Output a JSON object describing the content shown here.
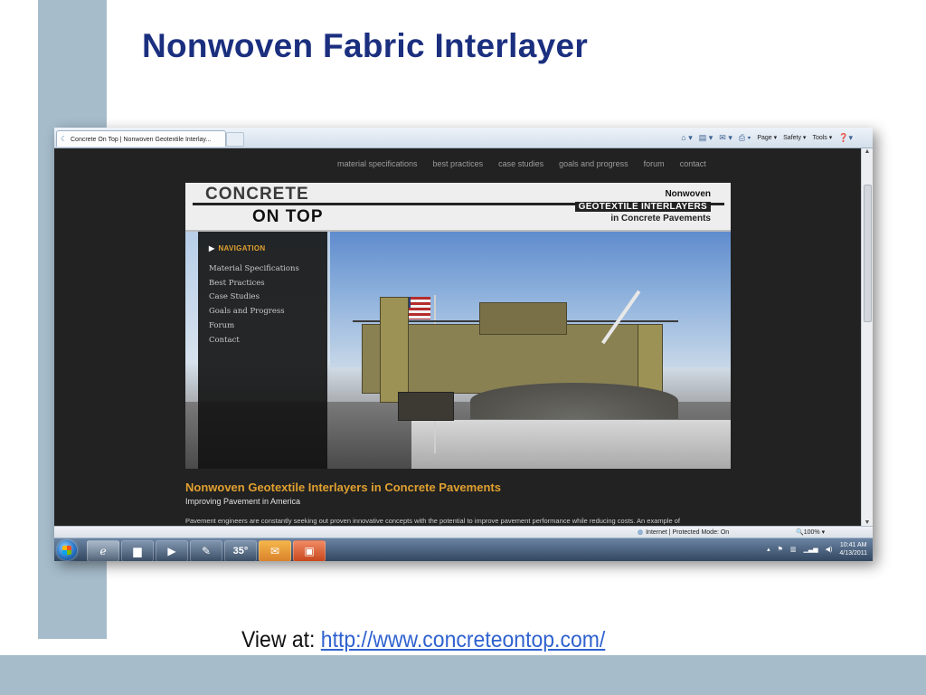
{
  "slide": {
    "title": "Nonwoven Fabric Interlayer",
    "view_label": "View at:",
    "link": "http://www.concreteontop.com/"
  },
  "browser": {
    "tab_title": "Concrete On Top | Nonwoven Geotextile Interlay...",
    "toolbar": {
      "page": "Page ▾",
      "safety": "Safety ▾",
      "tools": "Tools ▾"
    },
    "status": {
      "zone": "Internet | Protected Mode: On",
      "zoom": "100%"
    }
  },
  "site": {
    "topnav": [
      "material specifications",
      "best practices",
      "case studies",
      "goals and progress",
      "forum",
      "contact"
    ],
    "brand": {
      "line1": "CONCRETE",
      "line2": "ON TOP",
      "tag1": "Nonwoven",
      "tag2": "GEOTEXTILE INTERLAYERS",
      "tag3": "in Concrete Pavements"
    },
    "navigation": {
      "heading": "NAVIGATION",
      "items": [
        "Material Specifications",
        "Best Practices",
        "Case Studies",
        "Goals and Progress",
        "Forum",
        "Contact"
      ]
    },
    "article": {
      "title": "Nonwoven Geotextile Interlayers in Concrete Pavements",
      "subtitle": "Improving Pavement in America",
      "body": "Pavement engineers are constantly seeking out proven innovative concepts with the potential to improve pavement performance while reducing costs. An example of"
    }
  },
  "taskbar": {
    "weather_temp": "35°",
    "clock_time": "10:41 AM",
    "clock_date": "4/13/2011"
  },
  "colors": {
    "slide_title": "#1b2f7f",
    "accent_bar": "#a6bccb",
    "site_accent": "#e0a030",
    "link": "#2f62cf"
  }
}
